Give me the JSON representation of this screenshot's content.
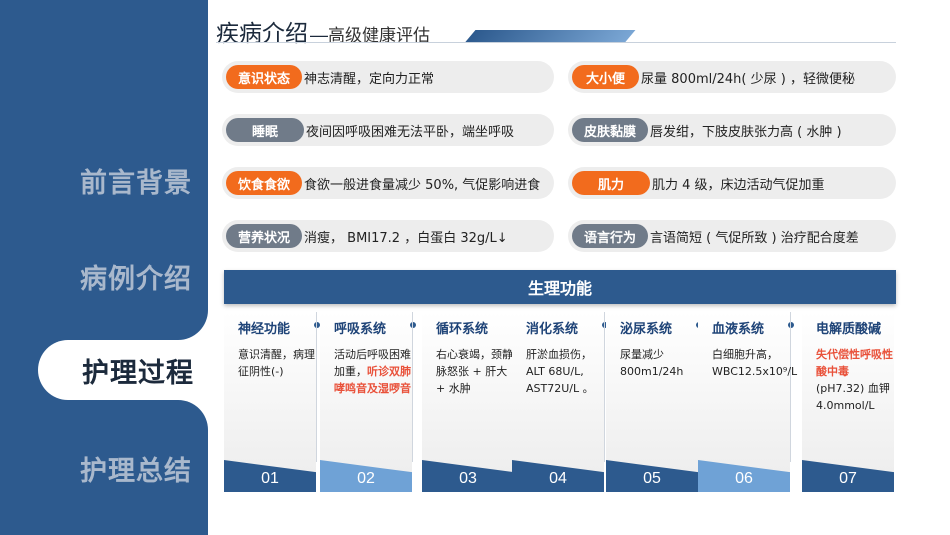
{
  "sidebar": {
    "items": [
      {
        "label": "前言背景"
      },
      {
        "label": "病例介绍"
      },
      {
        "label": "护理过程"
      },
      {
        "label": "护理总结"
      }
    ],
    "active_index": 2
  },
  "title": {
    "main": "疾病介绍",
    "separator": "—",
    "sub": "高级健康评估"
  },
  "assessment": {
    "left": [
      {
        "tag": "意识状态",
        "value": "神志清醒，定向力正常"
      },
      {
        "tag": "睡眠",
        "value": "夜间因呼吸困难无法平卧，端坐呼吸"
      },
      {
        "tag": "饮食食欲",
        "value": "食欲一般进食量减少 50%, 气促影响进食"
      },
      {
        "tag": "营养状况",
        "value": "消瘦， BMI17.2 ，白蛋白 32g/L↓"
      }
    ],
    "right": [
      {
        "tag": "大小便",
        "value": "尿量 800ml/24h( 少尿 ) ，轻微便秘"
      },
      {
        "tag": "皮肤黏膜",
        "value": "唇发绀，下肢皮肤张力高 ( 水肿 )"
      },
      {
        "tag": "肌力",
        "value": "肌力 4 级，床边活动气促加重"
      },
      {
        "tag": "语言行为",
        "value": "言语简短 ( 气促所致 ) 治疗配合度差"
      }
    ]
  },
  "physiology": {
    "header": "生理功能",
    "columns": [
      {
        "title": "神经功能",
        "text": "意识清醒，病理征阴性(-)",
        "highlight": "",
        "text_after": "",
        "num": "01"
      },
      {
        "title": "呼吸系统",
        "text": "活动后呼吸困难加重，",
        "highlight": "听诊双肺哮鸣音及湿啰音",
        "text_after": "",
        "num": "02"
      },
      {
        "title": "循环系统",
        "text": "右心衰竭，颈静脉怒张 + 肝大 + 水肿",
        "highlight": "",
        "text_after": "",
        "num": "03"
      },
      {
        "title": "消化系统",
        "text": "肝淤血损伤，ALT 68U/L, AST72U/L 。",
        "highlight": "",
        "text_after": "",
        "num": "04"
      },
      {
        "title": "泌尿系统",
        "text": "尿量减少 800m1/24h",
        "highlight": "",
        "text_after": "",
        "num": "05"
      },
      {
        "title": "血液系统",
        "text": "白细胞升高，WBC12.5x10⁹/L",
        "highlight": "",
        "text_after": "",
        "num": "06"
      },
      {
        "title": "电解质酸碱",
        "text": "",
        "highlight": "失代偿性呼吸性酸中毒",
        "text_after": "(pH7.32) 血钾 4.0mmol/L",
        "num": "07"
      }
    ]
  },
  "colors": {
    "sidebar": "#2d5a8e",
    "accent_orange": "#f26b1d",
    "tag_gray": "#707b89",
    "highlight_red": "#e9513a"
  }
}
